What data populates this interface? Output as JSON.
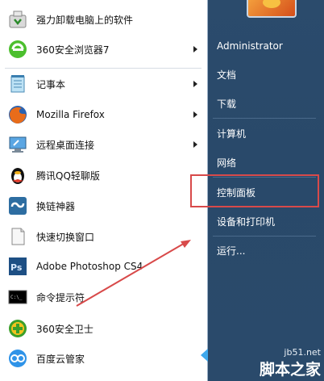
{
  "programs": [
    {
      "label": "强力卸载电脑上的软件",
      "icon": "uninstaller-icon",
      "has_arrow": false
    },
    {
      "label": "360安全浏览器7",
      "icon": "browser-360-icon",
      "has_arrow": true
    },
    {
      "label": "记事本",
      "icon": "notepad-icon",
      "has_arrow": true
    },
    {
      "label": "Mozilla Firefox",
      "icon": "firefox-icon",
      "has_arrow": true
    },
    {
      "label": "远程桌面连接",
      "icon": "remote-desktop-icon",
      "has_arrow": true
    },
    {
      "label": "腾讯QQ轻聊版",
      "icon": "qq-penguin-icon",
      "has_arrow": false
    },
    {
      "label": "换链神器",
      "icon": "link-changer-icon",
      "has_arrow": false
    },
    {
      "label": "快速切换窗口",
      "icon": "switch-window-icon",
      "has_arrow": false
    },
    {
      "label": "Adobe Photoshop CS4",
      "icon": "photoshop-icon",
      "has_arrow": false
    },
    {
      "label": "命令提示符",
      "icon": "cmd-icon",
      "has_arrow": false
    },
    {
      "label": "360安全卫士",
      "icon": "security-360-icon",
      "has_arrow": false
    },
    {
      "label": "百度云管家",
      "icon": "baidu-cloud-icon",
      "has_arrow": false
    }
  ],
  "right_menu": {
    "user": "Administrator",
    "items": [
      "文档",
      "下载",
      "计算机",
      "网络",
      "控制面板",
      "设备和打印机",
      "运行..."
    ]
  },
  "watermark": {
    "line1": "jb51.net",
    "line2": "脚本之家"
  },
  "colors": {
    "highlight": "#d84a4a",
    "right_pane": "#2b4b6c"
  }
}
